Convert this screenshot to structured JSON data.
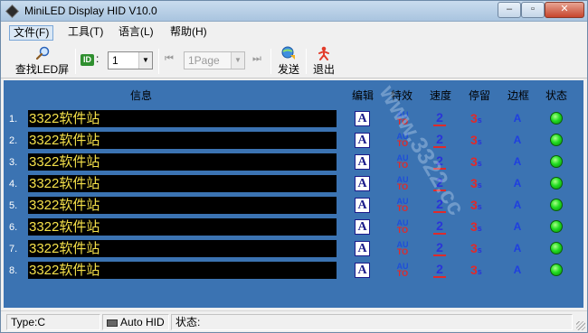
{
  "window": {
    "title": "MiniLED Display HID V10.0"
  },
  "window_buttons": {
    "minimize": "–",
    "maximize": "▫",
    "close": "✕"
  },
  "menu": {
    "items": [
      "文件(F)",
      "工具(T)",
      "语言(L)",
      "帮助(H)"
    ]
  },
  "toolbar": {
    "find_label": "查找LED屏",
    "id_badge": "ID",
    "id_colon": ":",
    "id_value": "1",
    "page_value": "1Page",
    "first": "⏮",
    "last": "⏭",
    "send_label": "发送",
    "exit_label": "退出"
  },
  "columns": {
    "info": "信息",
    "edit": "编辑",
    "effect": "特效",
    "speed": "速度",
    "stay": "停留",
    "border": "边框",
    "status": "状态"
  },
  "rows": [
    {
      "num": "1.",
      "text": "3322软件站",
      "edit": "A",
      "effect_top": "AU",
      "effect_bottom": "TO",
      "speed": "2",
      "stay": "3",
      "stay_unit": "s",
      "border": "A"
    },
    {
      "num": "2.",
      "text": "3322软件站",
      "edit": "A",
      "effect_top": "AU",
      "effect_bottom": "TO",
      "speed": "2",
      "stay": "3",
      "stay_unit": "s",
      "border": "A"
    },
    {
      "num": "3.",
      "text": "3322软件站",
      "edit": "A",
      "effect_top": "AU",
      "effect_bottom": "TO",
      "speed": "2",
      "stay": "3",
      "stay_unit": "s",
      "border": "A"
    },
    {
      "num": "4.",
      "text": "3322软件站",
      "edit": "A",
      "effect_top": "AU",
      "effect_bottom": "TO",
      "speed": "2",
      "stay": "3",
      "stay_unit": "s",
      "border": "A"
    },
    {
      "num": "5.",
      "text": "3322软件站",
      "edit": "A",
      "effect_top": "AU",
      "effect_bottom": "TO",
      "speed": "2",
      "stay": "3",
      "stay_unit": "s",
      "border": "A"
    },
    {
      "num": "6.",
      "text": "3322软件站",
      "edit": "A",
      "effect_top": "AU",
      "effect_bottom": "TO",
      "speed": "2",
      "stay": "3",
      "stay_unit": "s",
      "border": "A"
    },
    {
      "num": "7.",
      "text": "3322软件站",
      "edit": "A",
      "effect_top": "AU",
      "effect_bottom": "TO",
      "speed": "2",
      "stay": "3",
      "stay_unit": "s",
      "border": "A"
    },
    {
      "num": "8.",
      "text": "3322软件站",
      "edit": "A",
      "effect_top": "AU",
      "effect_bottom": "TO",
      "speed": "2",
      "stay": "3",
      "stay_unit": "s",
      "border": "A"
    }
  ],
  "statusbar": {
    "type": "Type:C",
    "mode": "Auto HID",
    "status": "状态:"
  },
  "watermark": "www.3322.cc",
  "colors": {
    "panel": "#3b73b2",
    "info_bg": "#000000",
    "info_text": "#f5e14a",
    "status_ok": "#22dd22"
  },
  "icons": {
    "find": "magnifier-icon",
    "send": "globe-send-icon",
    "exit": "exit-figure-icon"
  }
}
